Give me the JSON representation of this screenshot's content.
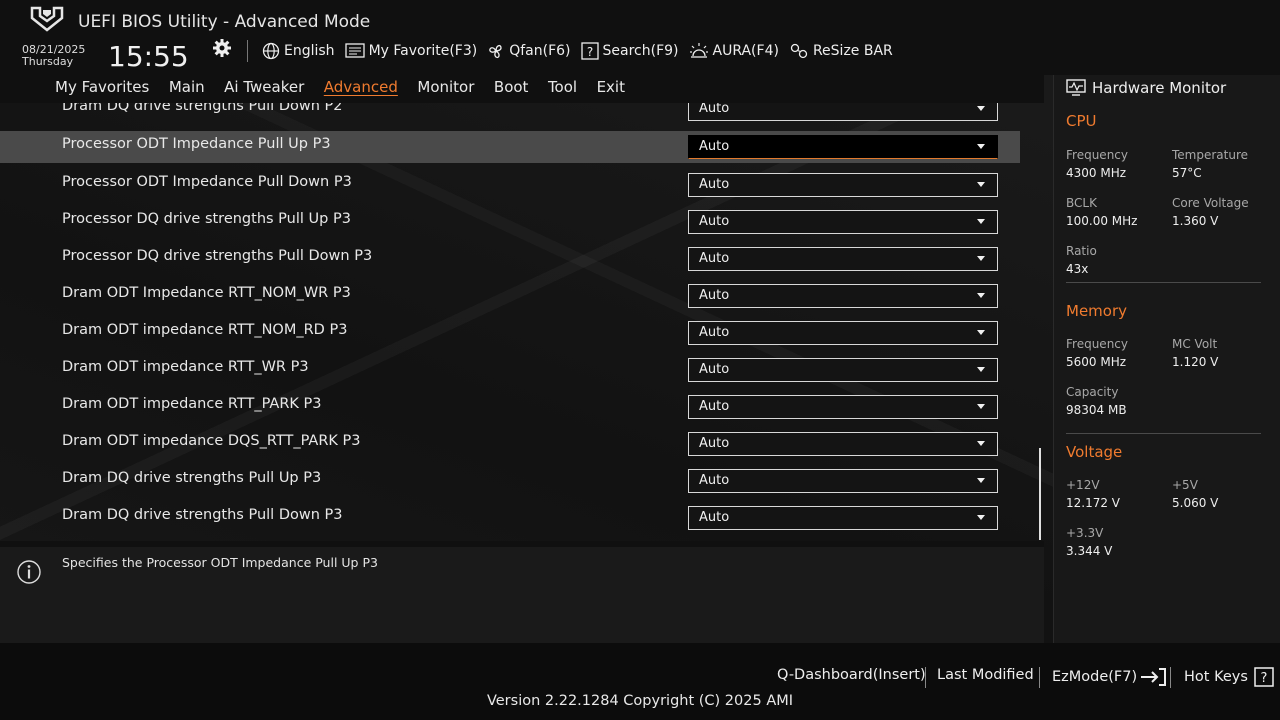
{
  "header": {
    "title": "UEFI BIOS Utility - Advanced Mode",
    "date": "08/21/2025",
    "day": "Thursday",
    "time": "15:55",
    "toolbar": [
      {
        "icon": "globe-icon",
        "label": "English"
      },
      {
        "icon": "star-list-icon",
        "label": "My Favorite(F3)"
      },
      {
        "icon": "fan-icon",
        "label": "Qfan(F6)"
      },
      {
        "icon": "question-box-icon",
        "label": "Search(F9)"
      },
      {
        "icon": "aura-light-icon",
        "label": "AURA(F4)"
      },
      {
        "icon": "resize-bar-icon",
        "label": "ReSize BAR"
      }
    ]
  },
  "menu": {
    "tabs": [
      "My Favorites",
      "Main",
      "Ai Tweaker",
      "Advanced",
      "Monitor",
      "Boot",
      "Tool",
      "Exit"
    ],
    "active": "Advanced"
  },
  "settings": {
    "partial_label": "Dram DQ drive strengths Pull Down P2",
    "partial_value": "Auto",
    "rows": [
      {
        "label": "Processor ODT Impedance Pull Up P3",
        "value": "Auto"
      },
      {
        "label": "Processor ODT Impedance Pull Down P3",
        "value": "Auto"
      },
      {
        "label": "Processor DQ drive strengths Pull Up P3",
        "value": "Auto"
      },
      {
        "label": "Processor DQ drive strengths Pull Down P3",
        "value": "Auto"
      },
      {
        "label": "Dram ODT Impedance RTT_NOM_WR P3",
        "value": "Auto"
      },
      {
        "label": "Dram ODT impedance RTT_NOM_RD P3",
        "value": "Auto"
      },
      {
        "label": "Dram ODT impedance RTT_WR P3",
        "value": "Auto"
      },
      {
        "label": "Dram ODT impedance RTT_PARK P3",
        "value": "Auto"
      },
      {
        "label": "Dram ODT impedance DQS_RTT_PARK P3",
        "value": "Auto"
      },
      {
        "label": "Dram DQ drive strengths Pull Up P3",
        "value": "Auto"
      },
      {
        "label": "Dram DQ drive strengths Pull Down P3",
        "value": "Auto"
      }
    ]
  },
  "help": {
    "text": "Specifies the Processor ODT Impedance Pull Up P3"
  },
  "hardware_monitor": {
    "title": "Hardware Monitor",
    "cpu": {
      "title": "CPU",
      "frequency_label": "Frequency",
      "frequency": "4300 MHz",
      "temperature_label": "Temperature",
      "temperature": "57°C",
      "bclk_label": "BCLK",
      "bclk": "100.00 MHz",
      "core_voltage_label": "Core Voltage",
      "core_voltage": "1.360 V",
      "ratio_label": "Ratio",
      "ratio": "43x"
    },
    "memory": {
      "title": "Memory",
      "frequency_label": "Frequency",
      "frequency": "5600 MHz",
      "mc_volt_label": "MC Volt",
      "mc_volt": "1.120 V",
      "capacity_label": "Capacity",
      "capacity": "98304 MB"
    },
    "voltage": {
      "title": "Voltage",
      "v12_label": "+12V",
      "v12": "12.172 V",
      "v5_label": "+5V",
      "v5": "5.060 V",
      "v33_label": "+3.3V",
      "v33": "3.344 V"
    }
  },
  "footer": {
    "q_dashboard": "Q-Dashboard(Insert)",
    "last_modified": "Last Modified",
    "ezmode": "EzMode(F7)",
    "hot_keys": "Hot Keys",
    "version": "Version 2.22.1284 Copyright (C) 2025 AMI"
  },
  "colors": {
    "accent": "#f07b2f",
    "selected_row": "#4a4a4a",
    "background": "#161616"
  }
}
